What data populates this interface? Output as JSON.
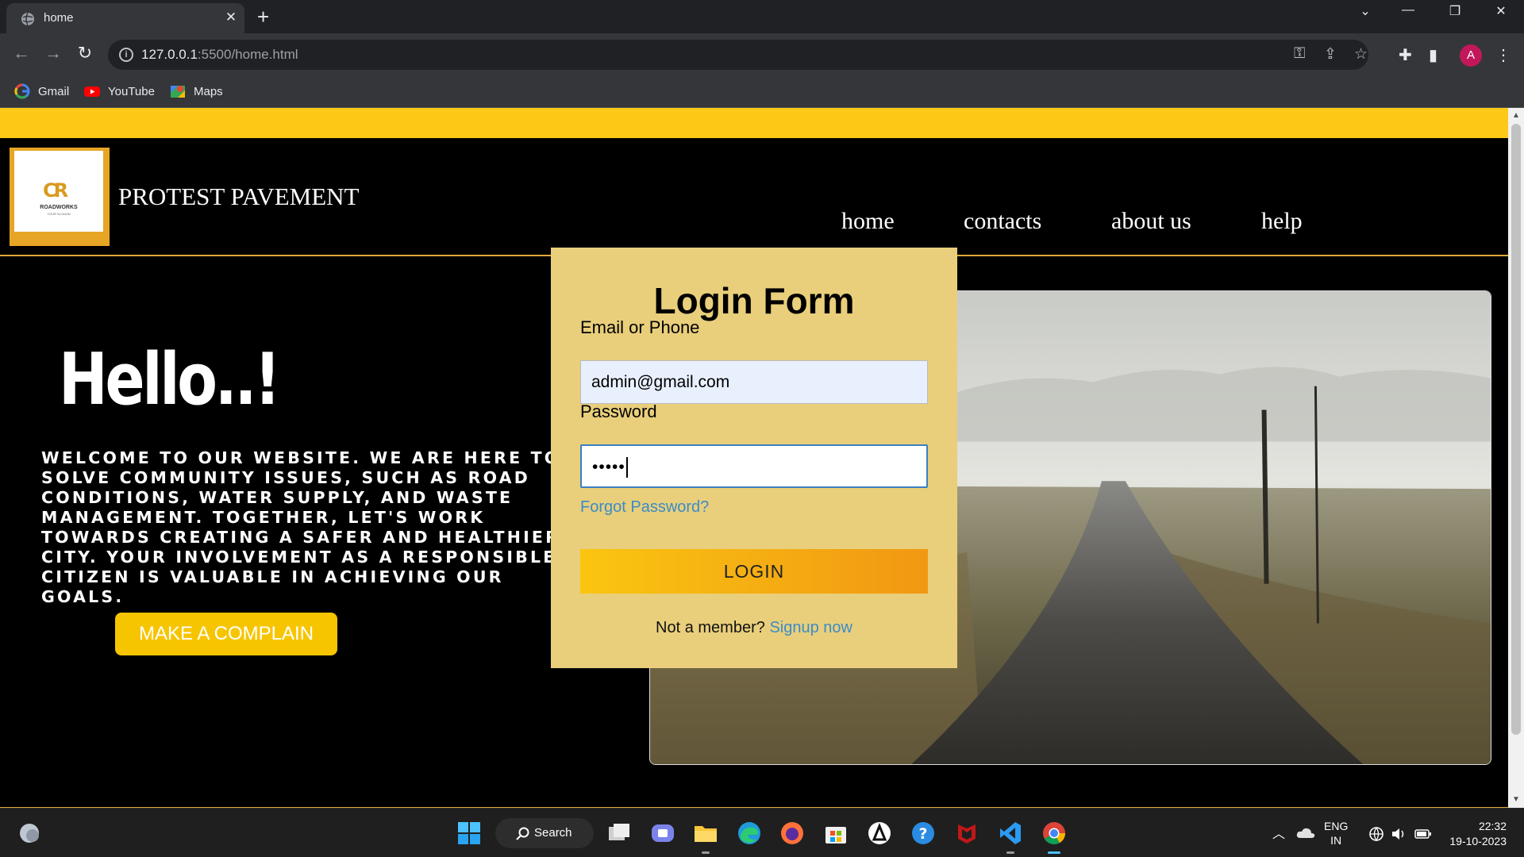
{
  "browser": {
    "tab_title": "home",
    "url_host": "127.0.0.1",
    "url_path": ":5500/home.html",
    "profile_initial": "A",
    "bookmarks": [
      {
        "label": "Gmail",
        "icon": "google-icon"
      },
      {
        "label": "YouTube",
        "icon": "youtube-icon"
      },
      {
        "label": "Maps",
        "icon": "maps-icon"
      }
    ]
  },
  "site": {
    "name": "PROTEST PAVEMENT",
    "logo_text": "ROADWORKS",
    "logo_sub": "YOUR SLOGAN",
    "logo_mark": "CR",
    "nav": [
      "home",
      "contacts",
      "about us",
      "help"
    ],
    "hello": "Hello..!",
    "welcome": "Welcome to our website. We are here to solve community issues, such as road conditions, water supply, and waste management. Together, let's work towards creating a safer and healthier city. Your involvement as a responsible citizen is valuable in achieving our goals.",
    "complain_button": "MAKE A COMPLAIN"
  },
  "login_form": {
    "title": "Login Form",
    "email_label": "Email or Phone",
    "email_value": "admin@gmail.com",
    "password_label": "Password",
    "password_value": "•••••",
    "forgot": "Forgot Password?",
    "login_button": "LOGIN",
    "member_text": "Not a member?",
    "signup_link": "Signup now"
  },
  "taskbar": {
    "search_label": "Search",
    "lang_top": "ENG",
    "lang_bottom": "IN",
    "time": "22:32",
    "date": "19-10-2023"
  },
  "colors": {
    "accent_yellow": "#fcc917",
    "form_bg": "#e9cf7b",
    "link_blue": "#3b8bc9"
  }
}
